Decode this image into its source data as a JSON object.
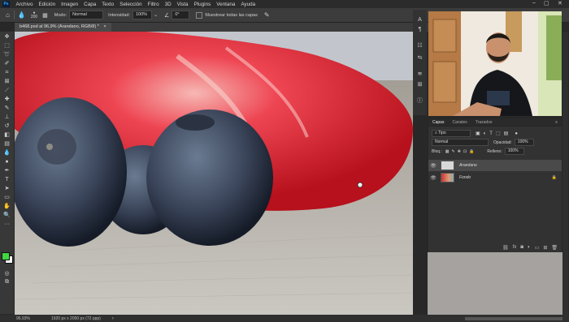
{
  "menubar": {
    "items": [
      "Archivo",
      "Edición",
      "Imagen",
      "Capa",
      "Texto",
      "Selección",
      "Filtro",
      "3D",
      "Vista",
      "Plugins",
      "Ventana",
      "Ayuda"
    ],
    "logo": "Ps"
  },
  "options": {
    "mode_label": "Modo:",
    "mode_value": "Normal",
    "intensity_label": "Intensidad:",
    "intensity_value": "100%",
    "angle_value": "0°",
    "sample_all_label": "Muestrear todas las capas",
    "brush_size": "200"
  },
  "document": {
    "tab_title": "b468.psd al 96,9% (Arandano, RGB/8) *",
    "close": "×"
  },
  "status": {
    "zoom": "96,93%",
    "info": "1920 px x 2000 px (72 ppp)"
  },
  "layers_panel": {
    "tabs": [
      "Capas",
      "Canales",
      "Trazados"
    ],
    "filter_label": "Tipo",
    "blend_mode": "Normal",
    "opacity_label": "Opacidad:",
    "opacity_value": "100%",
    "lock_label": "Bloq.:",
    "fill_label": "Relleno:",
    "fill_value": "100%",
    "layers": [
      {
        "name": "Arandano",
        "selected": true
      },
      {
        "name": "Fondo",
        "selected": false
      }
    ]
  },
  "icons": {
    "move": "move-icon",
    "eye": "eye-icon",
    "lock": "lock-icon"
  },
  "colors": {
    "foreground": "#3fd63f",
    "background": "#ffffff",
    "selection": "#4a4a4a"
  }
}
